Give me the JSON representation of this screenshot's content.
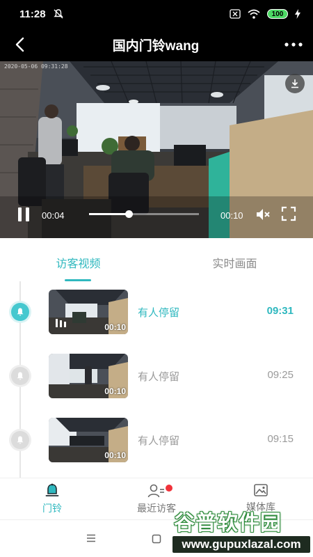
{
  "status_bar": {
    "time": "11:28",
    "battery": "100",
    "icons": [
      "mute-bell-icon",
      "sim-x-icon",
      "wifi-icon",
      "battery-icon",
      "charging-icon"
    ]
  },
  "header": {
    "title": "国内门铃wang",
    "back_icon": "back-arrow-icon",
    "more_icon": "more-dots-icon"
  },
  "video": {
    "timestamp": "2020-05-06 09:31:28",
    "current_time": "00:04",
    "duration": "00:10",
    "progress": 0.36,
    "playing": true
  },
  "tabs": [
    {
      "label": "访客视频",
      "active": true
    },
    {
      "label": "实时画面",
      "active": false
    }
  ],
  "events": [
    {
      "label": "有人停留",
      "time": "09:31",
      "duration": "00:10",
      "active": true
    },
    {
      "label": "有人停留",
      "time": "09:25",
      "duration": "00:10",
      "active": false
    },
    {
      "label": "有人停留",
      "time": "09:15",
      "duration": "00:10",
      "active": false
    }
  ],
  "bottom_nav": [
    {
      "label": "门铃",
      "icon": "doorbell-icon",
      "active": true
    },
    {
      "label": "最近访客",
      "icon": "visitors-icon",
      "active": false,
      "badge": true
    },
    {
      "label": "媒体库",
      "icon": "gallery-icon",
      "active": false
    }
  ],
  "watermark": {
    "title": "谷普软件园",
    "url": "www.gupuxlazal.com"
  },
  "colors": {
    "accent": "#2fb8bf",
    "badge": "#f0323a",
    "inactive": "#9a9a9a"
  }
}
